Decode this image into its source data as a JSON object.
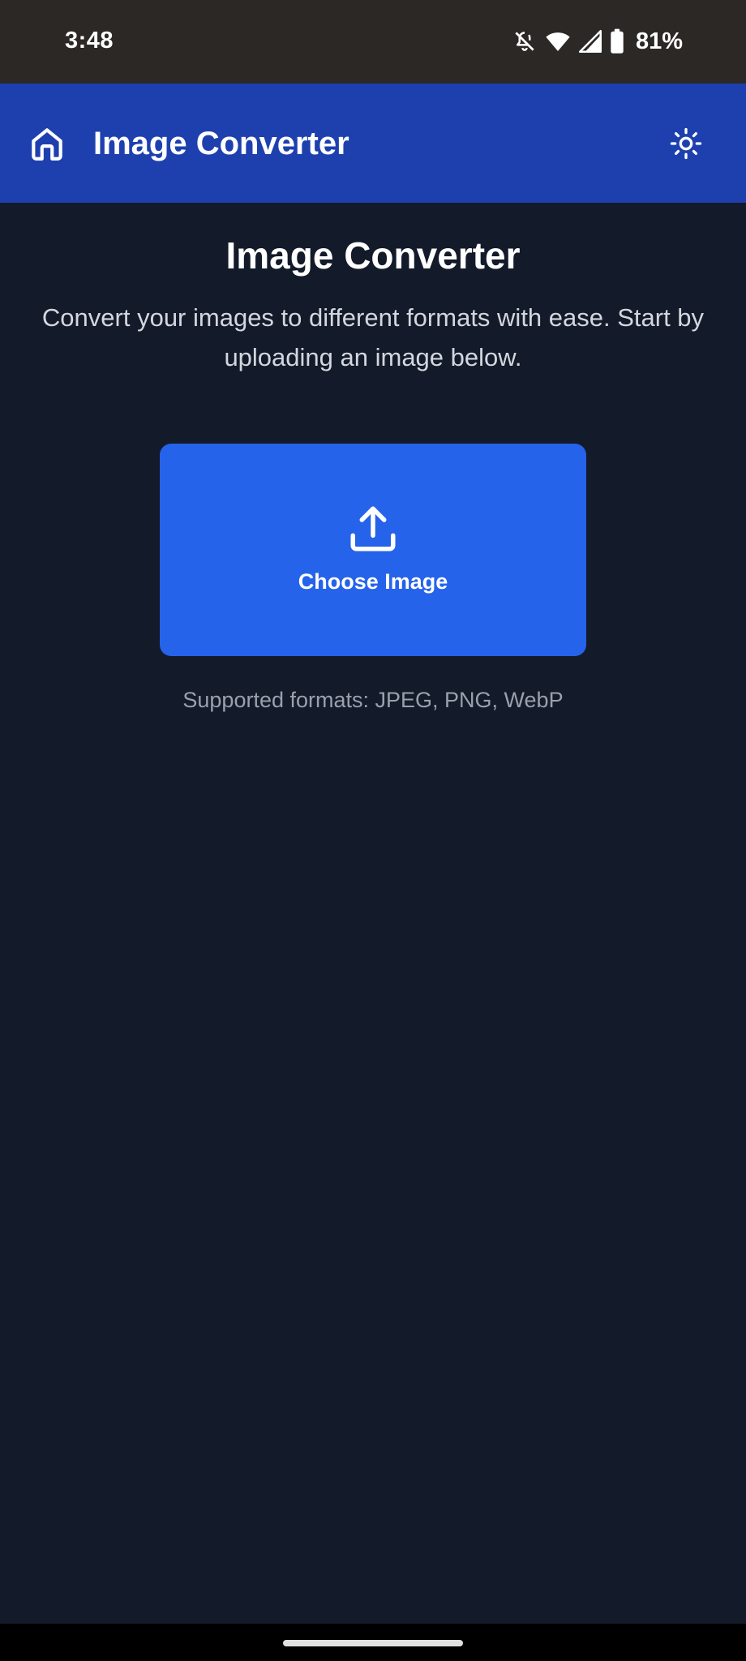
{
  "status_bar": {
    "time": "3:48",
    "battery_percent": "81%",
    "icons": [
      "mute-icon",
      "wifi-icon",
      "signal-icon",
      "battery-icon"
    ]
  },
  "app_bar": {
    "title": "Image Converter",
    "home_icon": "home-icon",
    "theme_icon": "sun-icon",
    "background_color": "#1e40af"
  },
  "main": {
    "title": "Image Converter",
    "description": "Convert your images to different formats with ease. Start by uploading an image below.",
    "upload_button": {
      "label": "Choose Image",
      "icon": "upload-icon",
      "color": "#2563eb"
    },
    "supported_formats": "Supported formats: JPEG, PNG, WebP"
  },
  "colors": {
    "page_background": "#131a29",
    "status_bar_background": "#2b2826"
  }
}
